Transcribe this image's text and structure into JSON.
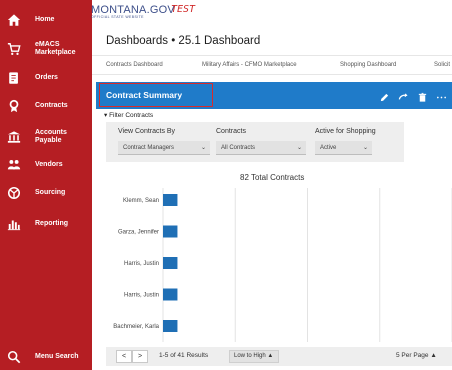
{
  "sidebar": {
    "items": [
      {
        "label": "Home",
        "icon": "home-icon"
      },
      {
        "label": "eMACS\nMarketplace",
        "icon": "cart-icon"
      },
      {
        "label": "Orders",
        "icon": "orders-icon"
      },
      {
        "label": "Contracts",
        "icon": "contract-icon"
      },
      {
        "label": "Accounts\nPayable",
        "icon": "bank-icon"
      },
      {
        "label": "Vendors",
        "icon": "vendors-icon"
      },
      {
        "label": "Sourcing",
        "icon": "sourcing-icon"
      },
      {
        "label": "Reporting",
        "icon": "reporting-icon"
      }
    ],
    "menu_search": "Menu Search"
  },
  "header": {
    "logo": "MONTANA.GOV",
    "logo_sub": "OFFICIAL STATE WEBSITE",
    "env": "TEST"
  },
  "breadcrumb": "Dashboards • 25.1 Dashboard",
  "tabs": [
    "Contracts Dashboard",
    "Military Affairs - CFMO Marketplace",
    "Shopping Dashboard",
    "Solicit"
  ],
  "widget": {
    "title": "Contract Summary",
    "filter_toggle": "Filter Contracts",
    "filters": [
      {
        "label": "View Contracts By",
        "value": "Contract Managers"
      },
      {
        "label": "Contracts",
        "value": "All Contracts"
      },
      {
        "label": "Active for Shopping",
        "value": "Active"
      }
    ],
    "total_label": "82 Total Contracts"
  },
  "chart_data": {
    "type": "bar",
    "orientation": "horizontal",
    "categories": [
      "Klemm, Sean",
      "Garza, Jennifer",
      "Harris, Justin",
      "Harris, Justin",
      "Bachmeier, Karla"
    ],
    "values": [
      1,
      1,
      1,
      1,
      1
    ],
    "xlim": [
      0,
      20
    ],
    "xticks": [
      "0",
      "5",
      "10",
      "15",
      "20"
    ],
    "grid": true,
    "bar_color": "#1f6fb5"
  },
  "pagination": {
    "prev": "<",
    "next": ">",
    "results": "1-5 of 41 Results",
    "sort": "Low to High ▲",
    "per_page": "5 Per Page ▲"
  },
  "colors": {
    "sidebar": "#b51e23",
    "accent": "#1f7bc9",
    "highlight": "#d92b2b"
  }
}
